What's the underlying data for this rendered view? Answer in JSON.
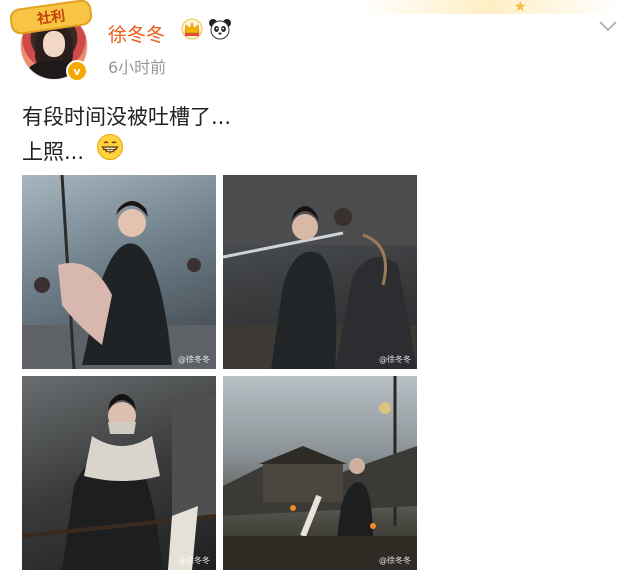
{
  "post": {
    "author": "徐冬冬",
    "time": "6小时前",
    "lines": [
      "有段时间没被吐槽了...",
      "上照..."
    ],
    "avatar_sticker": "社利",
    "verified_badge": "v",
    "badges": [
      "crown-icon",
      "panda-icon"
    ],
    "emoji": "grin-icon",
    "menu_icon": "chevron-down-icon"
  },
  "photos": [
    {
      "watermark": "@徐冬冬"
    },
    {
      "watermark": "@徐冬冬"
    },
    {
      "watermark": "@徐冬冬"
    },
    {
      "watermark": "@徐冬冬"
    }
  ],
  "colors": {
    "username": "#ea5b13",
    "timestamp": "#999999",
    "text": "#222222",
    "verified": "#f7a800"
  }
}
